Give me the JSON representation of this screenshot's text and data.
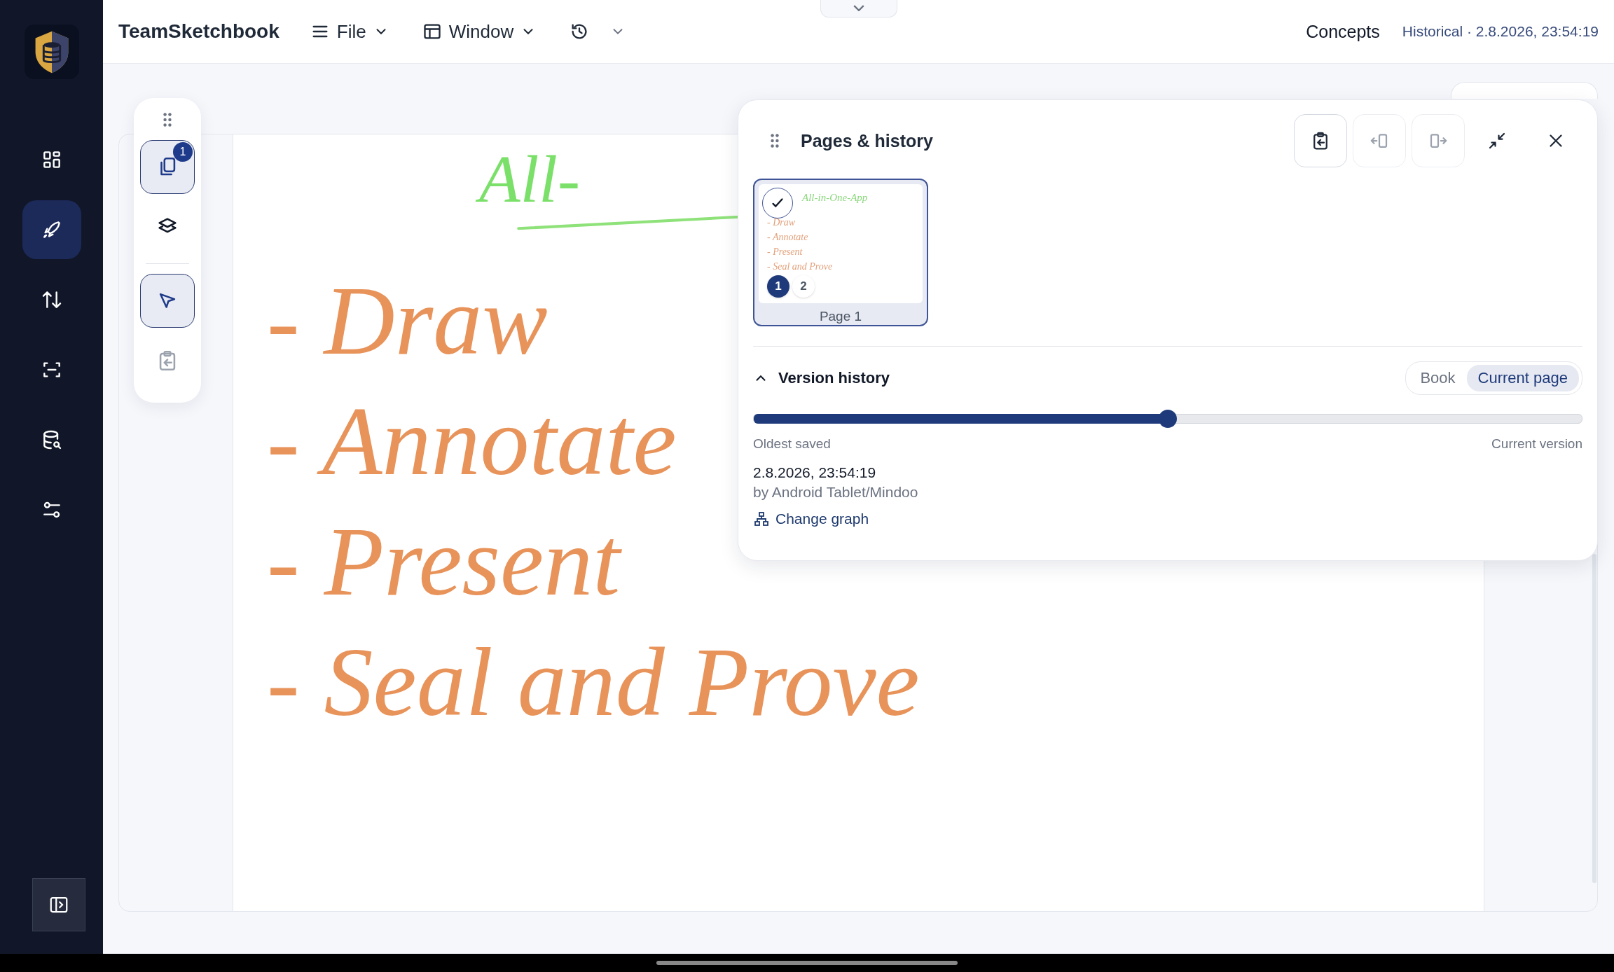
{
  "app": {
    "name": "TeamSketchbook"
  },
  "menus": [
    {
      "label": "File"
    },
    {
      "label": "Window"
    }
  ],
  "header_right": {
    "workspace": "Concepts",
    "status": "Historical · 2.8.2026, 23:54:19"
  },
  "sidebar": {
    "items": [
      {
        "selected": false
      },
      {
        "selected": true
      },
      {
        "selected": false
      },
      {
        "selected": false
      },
      {
        "selected": false
      },
      {
        "selected": false
      }
    ]
  },
  "tools": [
    {
      "selected": true,
      "disabled": false,
      "badge": "1"
    },
    {
      "selected": false,
      "disabled": false
    },
    {
      "selected": true,
      "disabled": false
    },
    {
      "selected": false,
      "disabled": true
    }
  ],
  "canvas": {
    "title": "All-",
    "lines": [
      "- Draw",
      "- Annotate",
      "- Present",
      "- Seal and Prove"
    ]
  },
  "panel": {
    "title": "Pages & history",
    "actions": [
      {
        "disabled": false
      },
      {
        "disabled": true
      },
      {
        "disabled": true
      },
      {
        "disabled": false
      },
      {
        "disabled": false
      }
    ],
    "pages": [
      {
        "label": "Page 1",
        "selected": true,
        "checked": true,
        "thumbnail": {
          "title": "All-in-One-App",
          "lines": [
            "- Draw",
            "- Annotate",
            "- Present",
            "- Seal and Prove"
          ]
        },
        "versions": [
          {
            "label": "1",
            "selected": true
          },
          {
            "label": "2",
            "selected": false
          }
        ]
      }
    ],
    "version_history": {
      "title": "Version history",
      "expanded": true,
      "scopes": [
        {
          "label": "Book",
          "selected": false
        },
        {
          "label": "Current page",
          "selected": true
        }
      ],
      "level": 0.5,
      "start_label": "Oldest saved",
      "end_label": "Current version",
      "date": "2.8.2026, 23:54:19",
      "author": "by Android Tablet/Mindoo",
      "link": "Change graph"
    }
  }
}
